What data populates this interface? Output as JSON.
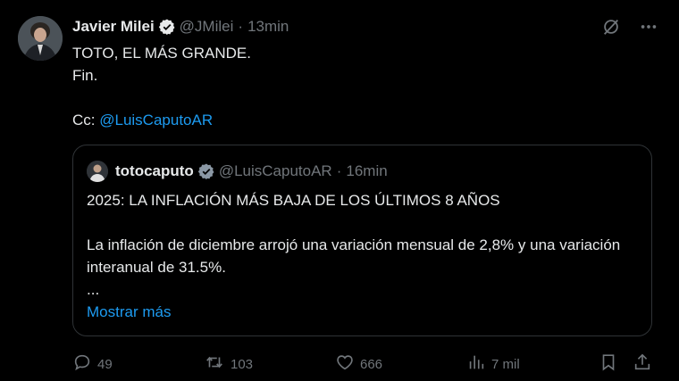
{
  "tweet": {
    "author_name": "Javier Milei",
    "author_handle": "@JMilei",
    "separator": "·",
    "time": "13min",
    "lines": [
      "TOTO, EL MÁS GRANDE.",
      "Fin.",
      "",
      "Cc: "
    ],
    "mention": "@LuisCaputoAR"
  },
  "quote": {
    "author_name": "totocaputo",
    "author_handle": "@LuisCaputoAR",
    "separator": "·",
    "time": "16min",
    "lines": [
      "2025: LA INFLACIÓN MÁS BAJA DE LOS ÚLTIMOS 8 AÑOS",
      "",
      "La inflación de diciembre arrojó una variación mensual de 2,8% y una variación interanual de 31.5%.",
      "..."
    ],
    "show_more": "Mostrar más"
  },
  "actions": {
    "replies": "49",
    "reposts": "103",
    "likes": "666",
    "views": "7 mil"
  },
  "icons": {
    "verified": "verified-badge-icon",
    "grok": "grok-icon",
    "more": "more-icon",
    "reply": "reply-icon",
    "repost": "repost-icon",
    "like": "heart-icon",
    "views": "views-icon",
    "bookmark": "bookmark-icon",
    "share": "share-icon"
  },
  "colors": {
    "background": "#000000",
    "text": "#e7e9ea",
    "muted": "#71767b",
    "link": "#1d9bf0",
    "border": "#2f3336"
  }
}
